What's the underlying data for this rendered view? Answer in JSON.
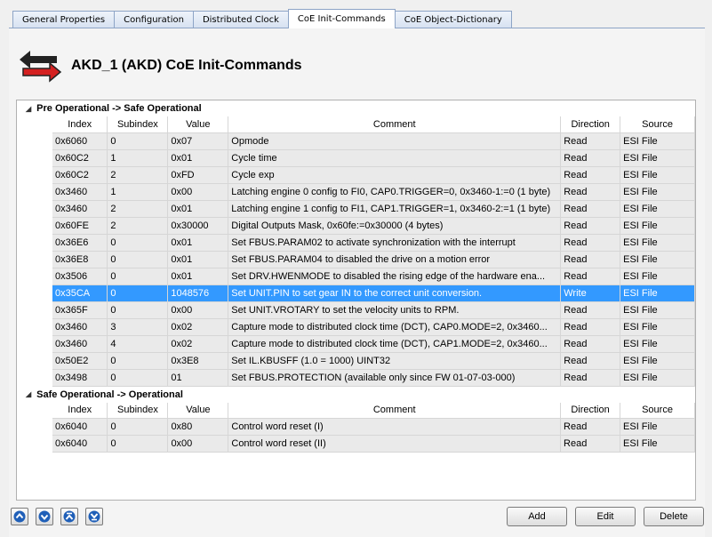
{
  "tabs": [
    "General Properties",
    "Configuration",
    "Distributed Clock",
    "CoE Init-Commands",
    "CoE Object-Dictionary"
  ],
  "active_tab": 3,
  "header": {
    "title": "AKD_1 (AKD) CoE Init-Commands"
  },
  "columns": [
    "Index",
    "Subindex",
    "Value",
    "Comment",
    "Direction",
    "Source"
  ],
  "groups": [
    {
      "label": "Pre Operational -> Safe Operational",
      "rows": [
        [
          "0x6060",
          "0",
          "0x07",
          "Opmode",
          "Read",
          "ESI File"
        ],
        [
          "0x60C2",
          "1",
          "0x01",
          "Cycle time",
          "Read",
          "ESI File"
        ],
        [
          "0x60C2",
          "2",
          "0xFD",
          "Cycle exp",
          "Read",
          "ESI File"
        ],
        [
          "0x3460",
          "1",
          "0x00",
          "Latching engine 0 config to FI0, CAP0.TRIGGER=0, 0x3460-1:=0 (1 byte)",
          "Read",
          "ESI File"
        ],
        [
          "0x3460",
          "2",
          "0x01",
          "Latching engine 1 config to FI1, CAP1.TRIGGER=1, 0x3460-2:=1 (1 byte)",
          "Read",
          "ESI File"
        ],
        [
          "0x60FE",
          "2",
          "0x30000",
          "Digital Outputs Mask, 0x60fe:=0x30000 (4 bytes)",
          "Read",
          "ESI File"
        ],
        [
          "0x36E6",
          "0",
          "0x01",
          "Set FBUS.PARAM02 to activate synchronization with the interrupt",
          "Read",
          "ESI File"
        ],
        [
          "0x36E8",
          "0",
          "0x01",
          "Set FBUS.PARAM04 to disabled the drive on a motion error",
          "Read",
          "ESI File"
        ],
        [
          "0x3506",
          "0",
          "0x01",
          "Set DRV.HWENMODE to disabled the rising edge of the hardware ena...",
          "Read",
          "ESI File"
        ],
        [
          "0x35CA",
          "0",
          "1048576",
          "Set UNIT.PIN to set gear IN to the correct unit conversion.",
          "Write",
          "ESI File"
        ],
        [
          "0x365F",
          "0",
          "0x00",
          "Set UNIT.VROTARY to set the velocity units to RPM.",
          "Read",
          "ESI File"
        ],
        [
          "0x3460",
          "3",
          "0x02",
          "Capture mode to distributed clock time (DCT), CAP0.MODE=2, 0x3460...",
          "Read",
          "ESI File"
        ],
        [
          "0x3460",
          "4",
          "0x02",
          "Capture mode to distributed clock time (DCT), CAP1.MODE=2, 0x3460...",
          "Read",
          "ESI File"
        ],
        [
          "0x50E2",
          "0",
          "0x3E8",
          "Set IL.KBUSFF (1.0 = 1000) UINT32",
          "Read",
          "ESI File"
        ],
        [
          "0x3498",
          "0",
          "01",
          "Set FBUS.PROTECTION (available only since FW 01-07-03-000)",
          "Read",
          "ESI File"
        ]
      ],
      "selected_row": 9
    },
    {
      "label": "Safe Operational -> Operational",
      "rows": [
        [
          "0x6040",
          "0",
          "0x80",
          "Control word reset (I)",
          "Read",
          "ESI File"
        ],
        [
          "0x6040",
          "0",
          "0x00",
          "Control word reset (II)",
          "Read",
          "ESI File"
        ]
      ],
      "selected_row": -1
    }
  ],
  "buttons": {
    "add": "Add",
    "edit": "Edit",
    "delete": "Delete"
  },
  "icon_buttons": [
    "move-up-icon",
    "move-down-icon",
    "move-top-icon",
    "move-bottom-icon"
  ],
  "colors": {
    "selection": "#3399ff",
    "row_bg": "#eaeaea",
    "arrow_red": "#d42020"
  }
}
